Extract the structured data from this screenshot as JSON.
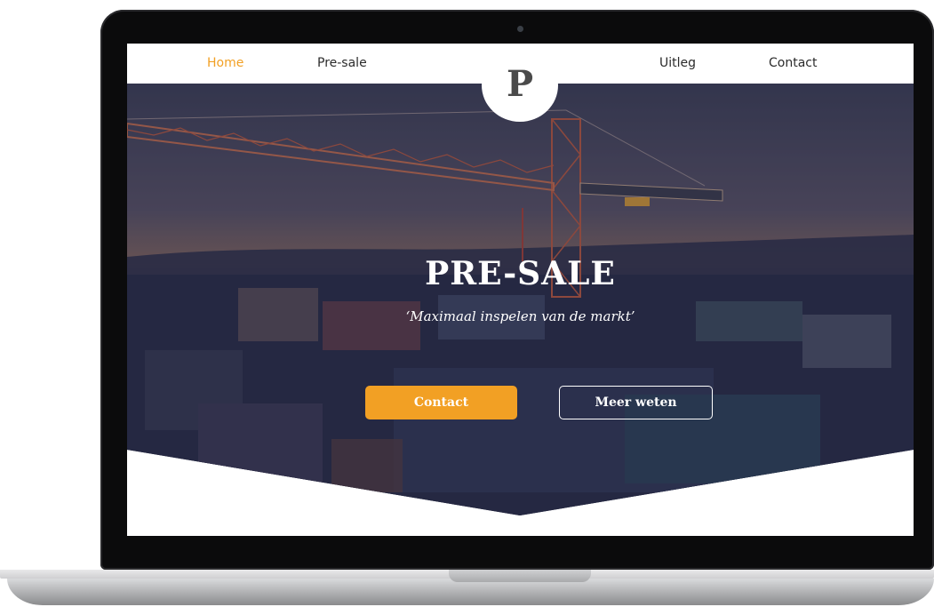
{
  "nav": {
    "links": [
      "Home",
      "Pre-sale",
      "Uitleg",
      "Contact"
    ],
    "active": "Home",
    "logo_letter": "P"
  },
  "hero": {
    "title": "PRE-SALE",
    "tagline": "‘Maximaal inspelen van de markt’",
    "primary_button": "Contact",
    "secondary_button": "Meer weten"
  },
  "colors": {
    "accent": "#f2a024",
    "overlay": "#2a2c4a",
    "bezel": "#0b0b0c"
  },
  "icons": {
    "logo": "p-monogram-logo",
    "camera": "webcam-dot"
  }
}
